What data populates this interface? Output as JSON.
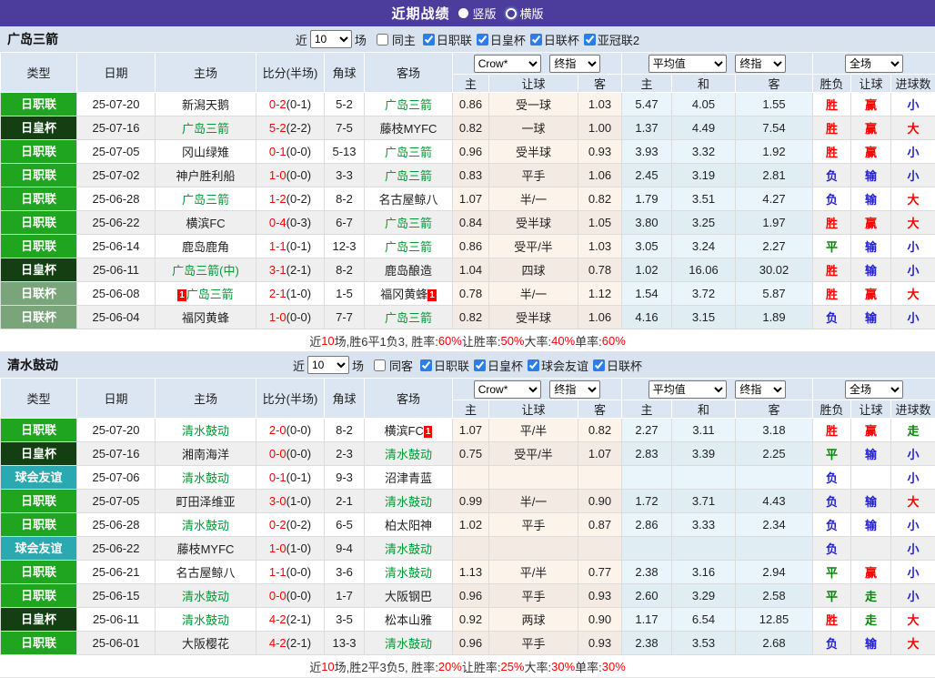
{
  "topbar": {
    "title": "近期战绩",
    "vertical_label": "竖版",
    "horizontal_label": "横版"
  },
  "colors": {
    "accent_purple": "#4C3D9C",
    "league_badge_green": "#1FA51F",
    "emperor_cup_dark_green": "#133F13",
    "league_cup_sage": "#7AA57A",
    "friendly_teal": "#2AAAB0",
    "focus_team_green": "#009933",
    "win_red": "#FF0000",
    "lose_blue": "#2222CC",
    "draw_green": "#008800"
  },
  "filter_labels": {
    "near": "近",
    "matches": "场"
  },
  "table_header": {
    "left_cols": [
      "类型",
      "日期",
      "主场",
      "比分(半场)",
      "角球",
      "客场"
    ],
    "odds_group": {
      "select1": "Crow*",
      "select2": "终指",
      "cols": [
        "主",
        "让球",
        "客"
      ]
    },
    "avg_group": {
      "select1": "平均值",
      "select2": "终指",
      "cols": [
        "主",
        "和",
        "客"
      ]
    },
    "result_group": {
      "select": "全场",
      "cols": [
        "胜负",
        "让球",
        "进球数"
      ]
    }
  },
  "sections": [
    {
      "team": "广岛三箭",
      "near_value": "10",
      "same_label": "同主",
      "same_checked": false,
      "leagues": [
        "日职联",
        "日皇杯",
        "日联杯",
        "亚冠联2"
      ],
      "rows": [
        {
          "league": "日职联",
          "league_style": "jl",
          "date": "25-07-20",
          "home": {
            "text": "新潟天鹅",
            "green": false
          },
          "score": "0-2",
          "half": "(0-1)",
          "corner": "5-2",
          "away": {
            "text": "广岛三箭",
            "green": true
          },
          "odds": [
            "0.86",
            "受一球",
            "1.03"
          ],
          "avg": [
            "5.47",
            "4.05",
            "1.55"
          ],
          "results": [
            {
              "text": "胜",
              "c": "r"
            },
            {
              "text": "赢",
              "c": "r"
            },
            {
              "text": "小",
              "c": "b"
            }
          ]
        },
        {
          "league": "日皇杯",
          "league_style": "jp",
          "date": "25-07-16",
          "home": {
            "text": "广岛三箭",
            "green": true
          },
          "score": "5-2",
          "half": "(2-2)",
          "corner": "7-5",
          "away": {
            "text": "藤枝MYFC",
            "green": false
          },
          "odds": [
            "0.82",
            "一球",
            "1.00"
          ],
          "avg": [
            "1.37",
            "4.49",
            "7.54"
          ],
          "results": [
            {
              "text": "胜",
              "c": "r"
            },
            {
              "text": "赢",
              "c": "r"
            },
            {
              "text": "大",
              "c": "r"
            }
          ]
        },
        {
          "league": "日职联",
          "league_style": "jl",
          "date": "25-07-05",
          "home": {
            "text": "冈山绿雉",
            "green": false
          },
          "score": "0-1",
          "half": "(0-0)",
          "corner": "5-13",
          "away": {
            "text": "广岛三箭",
            "green": true
          },
          "odds": [
            "0.96",
            "受半球",
            "0.93"
          ],
          "avg": [
            "3.93",
            "3.32",
            "1.92"
          ],
          "results": [
            {
              "text": "胜",
              "c": "r"
            },
            {
              "text": "赢",
              "c": "r"
            },
            {
              "text": "小",
              "c": "b"
            }
          ]
        },
        {
          "league": "日职联",
          "league_style": "jl",
          "date": "25-07-02",
          "home": {
            "text": "神户胜利船",
            "green": false
          },
          "score": "1-0",
          "half": "(0-0)",
          "corner": "3-3",
          "away": {
            "text": "广岛三箭",
            "green": true
          },
          "odds": [
            "0.83",
            "平手",
            "1.06"
          ],
          "avg": [
            "2.45",
            "3.19",
            "2.81"
          ],
          "results": [
            {
              "text": "负",
              "c": "b"
            },
            {
              "text": "输",
              "c": "b"
            },
            {
              "text": "小",
              "c": "b"
            }
          ]
        },
        {
          "league": "日职联",
          "league_style": "jl",
          "date": "25-06-28",
          "home": {
            "text": "广岛三箭",
            "green": true
          },
          "score": "1-2",
          "half": "(0-2)",
          "corner": "8-2",
          "away": {
            "text": "名古屋鲸八",
            "green": false
          },
          "odds": [
            "1.07",
            "半/一",
            "0.82"
          ],
          "avg": [
            "1.79",
            "3.51",
            "4.27"
          ],
          "results": [
            {
              "text": "负",
              "c": "b"
            },
            {
              "text": "输",
              "c": "b"
            },
            {
              "text": "大",
              "c": "r"
            }
          ]
        },
        {
          "league": "日职联",
          "league_style": "jl",
          "date": "25-06-22",
          "home": {
            "text": "横滨FC",
            "green": false
          },
          "score": "0-4",
          "half": "(0-3)",
          "corner": "6-7",
          "away": {
            "text": "广岛三箭",
            "green": true
          },
          "odds": [
            "0.84",
            "受半球",
            "1.05"
          ],
          "avg": [
            "3.80",
            "3.25",
            "1.97"
          ],
          "results": [
            {
              "text": "胜",
              "c": "r"
            },
            {
              "text": "赢",
              "c": "r"
            },
            {
              "text": "大",
              "c": "r"
            }
          ]
        },
        {
          "league": "日职联",
          "league_style": "jl",
          "date": "25-06-14",
          "home": {
            "text": "鹿岛鹿角",
            "green": false
          },
          "score": "1-1",
          "half": "(0-1)",
          "corner": "12-3",
          "away": {
            "text": "广岛三箭",
            "green": true
          },
          "odds": [
            "0.86",
            "受平/半",
            "1.03"
          ],
          "avg": [
            "3.05",
            "3.24",
            "2.27"
          ],
          "results": [
            {
              "text": "平",
              "c": "g"
            },
            {
              "text": "输",
              "c": "b"
            },
            {
              "text": "小",
              "c": "b"
            }
          ]
        },
        {
          "league": "日皇杯",
          "league_style": "jp",
          "date": "25-06-11",
          "home": {
            "text": "广岛三箭(中)",
            "green": true
          },
          "score": "3-1",
          "half": "(2-1)",
          "corner": "8-2",
          "away": {
            "text": "鹿岛酿造",
            "green": false
          },
          "odds": [
            "1.04",
            "四球",
            "0.78"
          ],
          "avg": [
            "1.02",
            "16.06",
            "30.02"
          ],
          "results": [
            {
              "text": "胜",
              "c": "r"
            },
            {
              "text": "输",
              "c": "b"
            },
            {
              "text": "小",
              "c": "b"
            }
          ]
        },
        {
          "league": "日联杯",
          "league_style": "jlc",
          "date": "25-06-08",
          "home": {
            "text": "广岛三箭",
            "green": true,
            "badge_pre": "1"
          },
          "score": "2-1",
          "half": "(1-0)",
          "corner": "1-5",
          "away": {
            "text": "福冈黄蜂",
            "green": false,
            "badge_post": "1"
          },
          "odds": [
            "0.78",
            "半/一",
            "1.12"
          ],
          "avg": [
            "1.54",
            "3.72",
            "5.87"
          ],
          "results": [
            {
              "text": "胜",
              "c": "r"
            },
            {
              "text": "赢",
              "c": "r"
            },
            {
              "text": "大",
              "c": "r"
            }
          ]
        },
        {
          "league": "日联杯",
          "league_style": "jlc",
          "date": "25-06-04",
          "home": {
            "text": "福冈黄蜂",
            "green": false
          },
          "score": "1-0",
          "half": "(0-0)",
          "corner": "7-7",
          "away": {
            "text": "广岛三箭",
            "green": true
          },
          "odds": [
            "0.82",
            "受半球",
            "1.06"
          ],
          "avg": [
            "4.16",
            "3.15",
            "1.89"
          ],
          "results": [
            {
              "text": "负",
              "c": "b"
            },
            {
              "text": "输",
              "c": "b"
            },
            {
              "text": "小",
              "c": "b"
            }
          ]
        }
      ],
      "summary": [
        {
          "t": "近",
          "c": "k"
        },
        {
          "t": "10",
          "c": "r"
        },
        {
          "t": "场,胜6平1负3, 胜率:",
          "c": "k"
        },
        {
          "t": "60%",
          "c": "r"
        },
        {
          "t": " 让胜率:",
          "c": "k"
        },
        {
          "t": "50%",
          "c": "r"
        },
        {
          "t": " 大率:",
          "c": "k"
        },
        {
          "t": "40%",
          "c": "r"
        },
        {
          "t": " 单率:",
          "c": "k"
        },
        {
          "t": "60%",
          "c": "r"
        }
      ]
    },
    {
      "team": "清水鼓动",
      "near_value": "10",
      "same_label": "同客",
      "same_checked": false,
      "leagues": [
        "日职联",
        "日皇杯",
        "球会友谊",
        "日联杯"
      ],
      "rows": [
        {
          "league": "日职联",
          "league_style": "jl",
          "date": "25-07-20",
          "home": {
            "text": "清水鼓动",
            "green": true
          },
          "score": "2-0",
          "half": "(0-0)",
          "corner": "8-2",
          "away": {
            "text": "横滨FC",
            "green": false,
            "badge_post": "1"
          },
          "odds": [
            "1.07",
            "平/半",
            "0.82"
          ],
          "avg": [
            "2.27",
            "3.11",
            "3.18"
          ],
          "results": [
            {
              "text": "胜",
              "c": "r"
            },
            {
              "text": "赢",
              "c": "r"
            },
            {
              "text": "走",
              "c": "g"
            }
          ]
        },
        {
          "league": "日皇杯",
          "league_style": "jp",
          "date": "25-07-16",
          "home": {
            "text": "湘南海洋",
            "green": false
          },
          "score": "0-0",
          "half": "(0-0)",
          "corner": "2-3",
          "away": {
            "text": "清水鼓动",
            "green": true
          },
          "odds": [
            "0.75",
            "受平/半",
            "1.07"
          ],
          "avg": [
            "2.83",
            "3.39",
            "2.25"
          ],
          "results": [
            {
              "text": "平",
              "c": "g"
            },
            {
              "text": "输",
              "c": "b"
            },
            {
              "text": "小",
              "c": "b"
            }
          ]
        },
        {
          "league": "球会友谊",
          "league_style": "fr",
          "date": "25-07-06",
          "home": {
            "text": "清水鼓动",
            "green": true
          },
          "score": "0-1",
          "half": "(0-1)",
          "corner": "9-3",
          "away": {
            "text": "沼津青蓝",
            "green": false
          },
          "odds": [
            "",
            "",
            ""
          ],
          "avg": [
            "",
            "",
            ""
          ],
          "results": [
            {
              "text": "负",
              "c": "b"
            },
            {
              "text": "",
              "c": ""
            },
            {
              "text": "小",
              "c": "b"
            }
          ]
        },
        {
          "league": "日职联",
          "league_style": "jl",
          "date": "25-07-05",
          "home": {
            "text": "町田泽维亚",
            "green": false
          },
          "score": "3-0",
          "half": "(1-0)",
          "corner": "2-1",
          "away": {
            "text": "清水鼓动",
            "green": true
          },
          "odds": [
            "0.99",
            "半/一",
            "0.90"
          ],
          "avg": [
            "1.72",
            "3.71",
            "4.43"
          ],
          "results": [
            {
              "text": "负",
              "c": "b"
            },
            {
              "text": "输",
              "c": "b"
            },
            {
              "text": "大",
              "c": "r"
            }
          ]
        },
        {
          "league": "日职联",
          "league_style": "jl",
          "date": "25-06-28",
          "home": {
            "text": "清水鼓动",
            "green": true
          },
          "score": "0-2",
          "half": "(0-2)",
          "corner": "6-5",
          "away": {
            "text": "柏太阳神",
            "green": false
          },
          "odds": [
            "1.02",
            "平手",
            "0.87"
          ],
          "avg": [
            "2.86",
            "3.33",
            "2.34"
          ],
          "results": [
            {
              "text": "负",
              "c": "b"
            },
            {
              "text": "输",
              "c": "b"
            },
            {
              "text": "小",
              "c": "b"
            }
          ]
        },
        {
          "league": "球会友谊",
          "league_style": "fr",
          "date": "25-06-22",
          "home": {
            "text": "藤枝MYFC",
            "green": false
          },
          "score": "1-0",
          "half": "(1-0)",
          "corner": "9-4",
          "away": {
            "text": "清水鼓动",
            "green": true
          },
          "odds": [
            "",
            "",
            ""
          ],
          "avg": [
            "",
            "",
            ""
          ],
          "results": [
            {
              "text": "负",
              "c": "b"
            },
            {
              "text": "",
              "c": ""
            },
            {
              "text": "小",
              "c": "b"
            }
          ]
        },
        {
          "league": "日职联",
          "league_style": "jl",
          "date": "25-06-21",
          "home": {
            "text": "名古屋鲸八",
            "green": false
          },
          "score": "1-1",
          "half": "(0-0)",
          "corner": "3-6",
          "away": {
            "text": "清水鼓动",
            "green": true
          },
          "odds": [
            "1.13",
            "平/半",
            "0.77"
          ],
          "avg": [
            "2.38",
            "3.16",
            "2.94"
          ],
          "results": [
            {
              "text": "平",
              "c": "g"
            },
            {
              "text": "赢",
              "c": "r"
            },
            {
              "text": "小",
              "c": "b"
            }
          ]
        },
        {
          "league": "日职联",
          "league_style": "jl",
          "date": "25-06-15",
          "home": {
            "text": "清水鼓动",
            "green": true
          },
          "score": "0-0",
          "half": "(0-0)",
          "corner": "1-7",
          "away": {
            "text": "大阪钢巴",
            "green": false
          },
          "odds": [
            "0.96",
            "平手",
            "0.93"
          ],
          "avg": [
            "2.60",
            "3.29",
            "2.58"
          ],
          "results": [
            {
              "text": "平",
              "c": "g"
            },
            {
              "text": "走",
              "c": "g"
            },
            {
              "text": "小",
              "c": "b"
            }
          ]
        },
        {
          "league": "日皇杯",
          "league_style": "jp",
          "date": "25-06-11",
          "home": {
            "text": "清水鼓动",
            "green": true
          },
          "score": "4-2",
          "half": "(2-1)",
          "corner": "3-5",
          "away": {
            "text": "松本山雅",
            "green": false
          },
          "odds": [
            "0.92",
            "两球",
            "0.90"
          ],
          "avg": [
            "1.17",
            "6.54",
            "12.85"
          ],
          "results": [
            {
              "text": "胜",
              "c": "r"
            },
            {
              "text": "走",
              "c": "g"
            },
            {
              "text": "大",
              "c": "r"
            }
          ]
        },
        {
          "league": "日职联",
          "league_style": "jl",
          "date": "25-06-01",
          "home": {
            "text": "大阪樱花",
            "green": false
          },
          "score": "4-2",
          "half": "(2-1)",
          "corner": "13-3",
          "away": {
            "text": "清水鼓动",
            "green": true
          },
          "odds": [
            "0.96",
            "平手",
            "0.93"
          ],
          "avg": [
            "2.38",
            "3.53",
            "2.68"
          ],
          "results": [
            {
              "text": "负",
              "c": "b"
            },
            {
              "text": "输",
              "c": "b"
            },
            {
              "text": "大",
              "c": "r"
            }
          ]
        }
      ],
      "summary": [
        {
          "t": "近",
          "c": "k"
        },
        {
          "t": "10",
          "c": "r"
        },
        {
          "t": "场,胜2平3负5, 胜率:",
          "c": "k"
        },
        {
          "t": "20%",
          "c": "r"
        },
        {
          "t": " 让胜率:",
          "c": "k"
        },
        {
          "t": "25%",
          "c": "r"
        },
        {
          "t": " 大率:",
          "c": "k"
        },
        {
          "t": "30%",
          "c": "r"
        },
        {
          "t": " 单率:",
          "c": "k"
        },
        {
          "t": "30%",
          "c": "r"
        }
      ]
    }
  ]
}
